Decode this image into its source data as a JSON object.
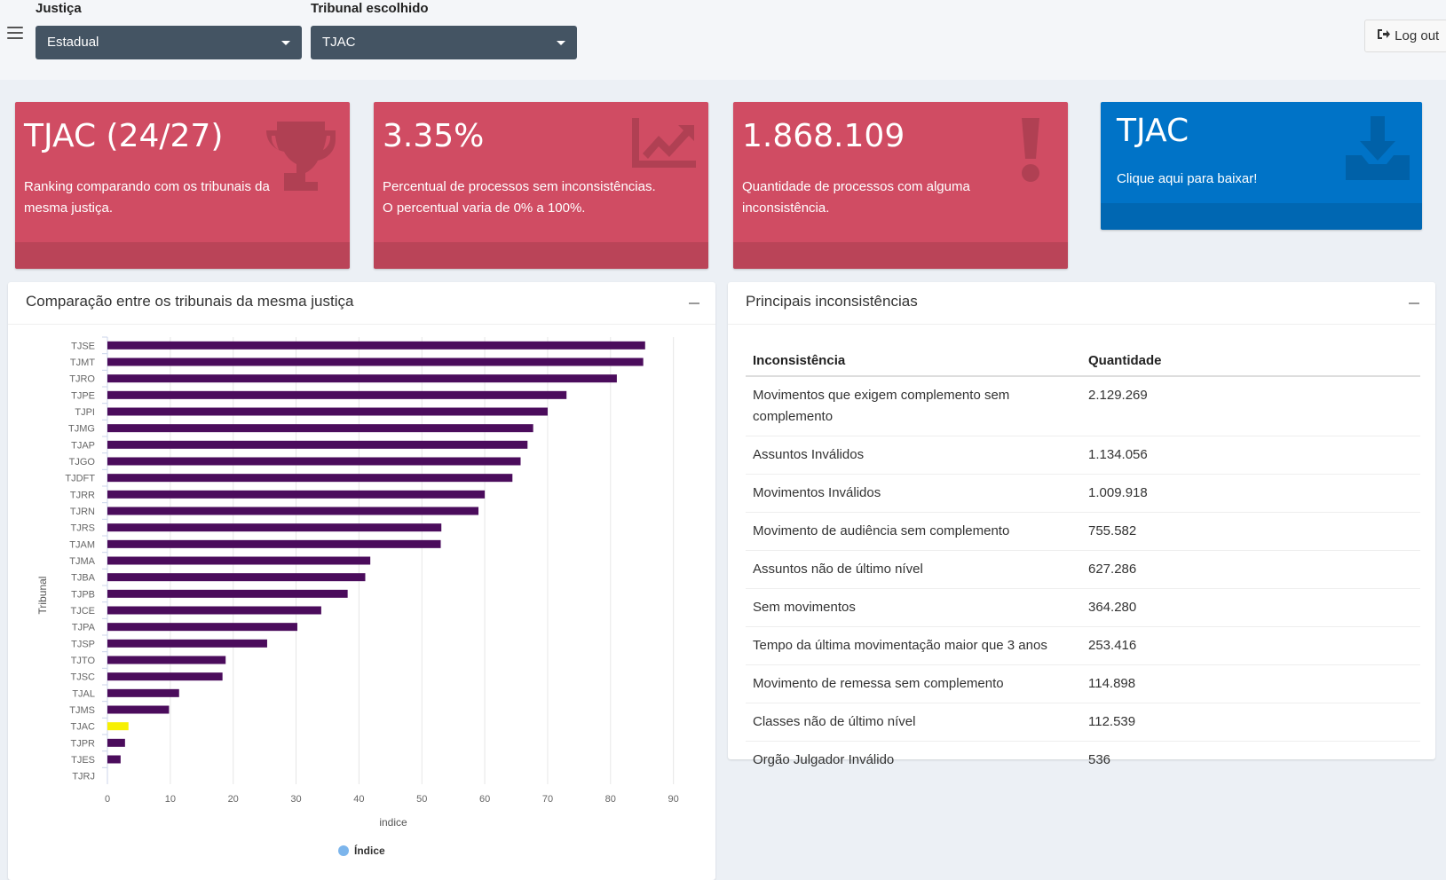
{
  "filters": {
    "justica_label": "Justiça",
    "justica_value": "Estadual",
    "tribunal_label": "Tribunal escolhido",
    "tribunal_value": "TJAC"
  },
  "header": {
    "logout_label": "Log out"
  },
  "value_boxes": [
    {
      "value": "TJAC (24/27)",
      "subtitle": "Ranking comparando com os tribunais da mesma justiça.",
      "icon": "trophy-icon"
    },
    {
      "value": "3.35%",
      "subtitle": "Percentual de processos sem inconsistências. O percentual varia de 0% a 100%.",
      "icon": "chart-line-icon"
    },
    {
      "value": "1.868.109",
      "subtitle": "Quantidade de processos com alguma inconsistência.",
      "icon": "exclamation-icon"
    },
    {
      "value": "TJAC",
      "subtitle": "Clique aqui para baixar!",
      "icon": "download-icon"
    }
  ],
  "colors": {
    "box_red": "#d04c63",
    "box_blue": "#0073c7",
    "bar": "#4b0c5c",
    "bar_highlight": "#f7f003",
    "legend_dot": "#7cb5ec"
  },
  "chart_panel": {
    "title": "Comparação entre os tribunais da mesma justiça"
  },
  "chart_data": {
    "type": "bar",
    "orientation": "horizontal",
    "categories": [
      "TJSE",
      "TJMT",
      "TJRO",
      "TJPE",
      "TJPI",
      "TJMG",
      "TJAP",
      "TJGO",
      "TJDFT",
      "TJRR",
      "TJRN",
      "TJRS",
      "TJAM",
      "TJMA",
      "TJBA",
      "TJPB",
      "TJCE",
      "TJPA",
      "TJSP",
      "TJTO",
      "TJSC",
      "TJAL",
      "TJMS",
      "TJAC",
      "TJPR",
      "TJES",
      "TJRJ"
    ],
    "series": [
      {
        "name": "Índice",
        "values": [
          85.5,
          85.2,
          81.0,
          73.0,
          70.0,
          67.7,
          66.8,
          65.7,
          64.4,
          60.0,
          59.0,
          53.1,
          53.0,
          41.8,
          41.0,
          38.2,
          34.0,
          30.2,
          25.4,
          18.8,
          18.3,
          11.4,
          9.8,
          3.35,
          2.8,
          2.1,
          0
        ]
      }
    ],
    "highlight": "TJAC",
    "xlabel": "indice",
    "ylabel": "Tribunal",
    "xlim": [
      0,
      90
    ],
    "xticks": [
      0,
      10,
      20,
      30,
      40,
      50,
      60,
      70,
      80,
      90
    ],
    "grid": true,
    "legend": "bottom-center"
  },
  "table_panel": {
    "title": "Principais inconsistências",
    "columns": [
      "Inconsistência",
      "Quantidade"
    ],
    "rows": [
      [
        "Movimentos que exigem complemento sem complemento",
        "2.129.269"
      ],
      [
        "Assuntos Inválidos",
        "1.134.056"
      ],
      [
        "Movimentos Inválidos",
        "1.009.918"
      ],
      [
        "Movimento de audiência sem complemento",
        "755.582"
      ],
      [
        "Assuntos não de último nível",
        "627.286"
      ],
      [
        "Sem movimentos",
        "364.280"
      ],
      [
        "Tempo da última movimentação maior que 3 anos",
        "253.416"
      ],
      [
        "Movimento de remessa sem complemento",
        "114.898"
      ],
      [
        "Classes não de último nível",
        "112.539"
      ],
      [
        "Orgão Julgador Inválido",
        "536"
      ]
    ]
  }
}
